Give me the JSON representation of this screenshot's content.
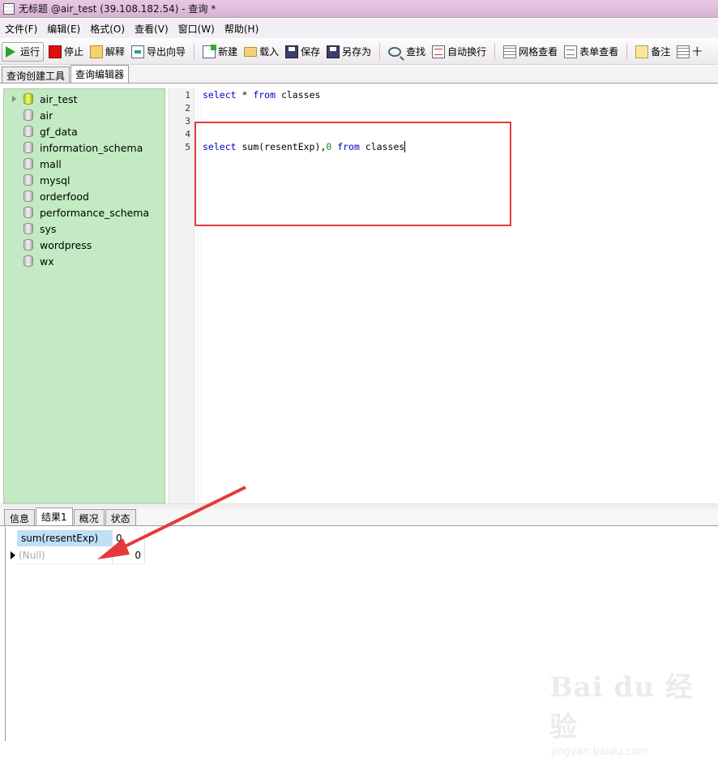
{
  "window": {
    "title": "无标题 @air_test (39.108.182.54) - 查询 *"
  },
  "menu": [
    "文件(F)",
    "编辑(E)",
    "格式(O)",
    "查看(V)",
    "窗口(W)",
    "帮助(H)"
  ],
  "toolbar": {
    "run": "运行",
    "stop": "停止",
    "explain": "解释",
    "export_wizard": "导出向导",
    "new": "新建",
    "load": "载入",
    "save": "保存",
    "save_as": "另存为",
    "find": "查找",
    "word_wrap": "自动换行",
    "grid_view": "网格查看",
    "form_view": "表单查看",
    "notes": "备注",
    "cut_off": "十"
  },
  "top_tabs": [
    "查询创建工具",
    "查询编辑器"
  ],
  "databases": [
    "air_test",
    "air",
    "gf_data",
    "information_schema",
    "mall",
    "mysql",
    "orderfood",
    "performance_schema",
    "sys",
    "wordpress",
    "wx"
  ],
  "editor": {
    "line_numbers": [
      "1",
      "2",
      "3",
      "4",
      "5"
    ],
    "line1": {
      "kw1": "select",
      "rest1": " * ",
      "kw2": "from",
      "rest2": " classes"
    },
    "line5": {
      "kw1": "select",
      "rest1": " sum(resentExp),",
      "num": "0",
      "sp": " ",
      "kw2": "from",
      "rest2": " classes"
    }
  },
  "bottom_tabs": [
    "信息",
    "结果1",
    "概况",
    "状态"
  ],
  "result_grid": {
    "columns": [
      "sum(resentExp)",
      "0"
    ],
    "rows": [
      [
        "(Null)",
        "0"
      ]
    ]
  },
  "watermark": {
    "logo": "Bai du 经验",
    "url": "jingyan.baidu.com"
  },
  "colors": {
    "title_bar": "#d7b2d3",
    "tree_bg": "#c3eac3",
    "highlight_box": "#e63a3a",
    "keyword": "#0000c8",
    "number": "#0a8a2a",
    "header_cell": "#bfe0f5"
  }
}
